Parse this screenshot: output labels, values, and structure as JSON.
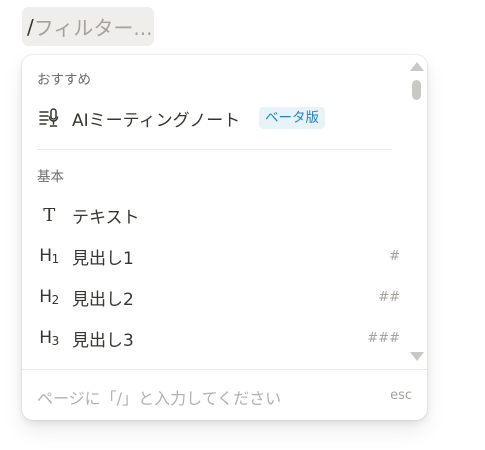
{
  "filter": {
    "slash": "/",
    "placeholder": "フィルター..."
  },
  "menu": {
    "sections": {
      "recommended": {
        "header": "おすすめ",
        "items": [
          {
            "label": "AIミーティングノート",
            "icon": "ai-meeting-notes-icon",
            "badge": "ベータ版"
          }
        ]
      },
      "basic": {
        "header": "基本",
        "items": [
          {
            "label": "テキスト",
            "icon": "text-icon",
            "icon_glyph": "T",
            "shortcut": ""
          },
          {
            "label": "見出し1",
            "icon": "heading-1-icon",
            "icon_glyph": "H",
            "icon_sub": "1",
            "shortcut": "#"
          },
          {
            "label": "見出し2",
            "icon": "heading-2-icon",
            "icon_glyph": "H",
            "icon_sub": "2",
            "shortcut": "##"
          },
          {
            "label": "見出し3",
            "icon": "heading-3-icon",
            "icon_glyph": "H",
            "icon_sub": "3",
            "shortcut": "###"
          }
        ]
      }
    },
    "footer": {
      "hint": "ページに「/」と入力してください",
      "esc": "esc"
    }
  },
  "colors": {
    "badge_bg": "#e7f3f8",
    "badge_text": "#2383c4",
    "chip_bg": "#efeeeb",
    "text": "#37352f",
    "muted": "#a5a29d"
  }
}
